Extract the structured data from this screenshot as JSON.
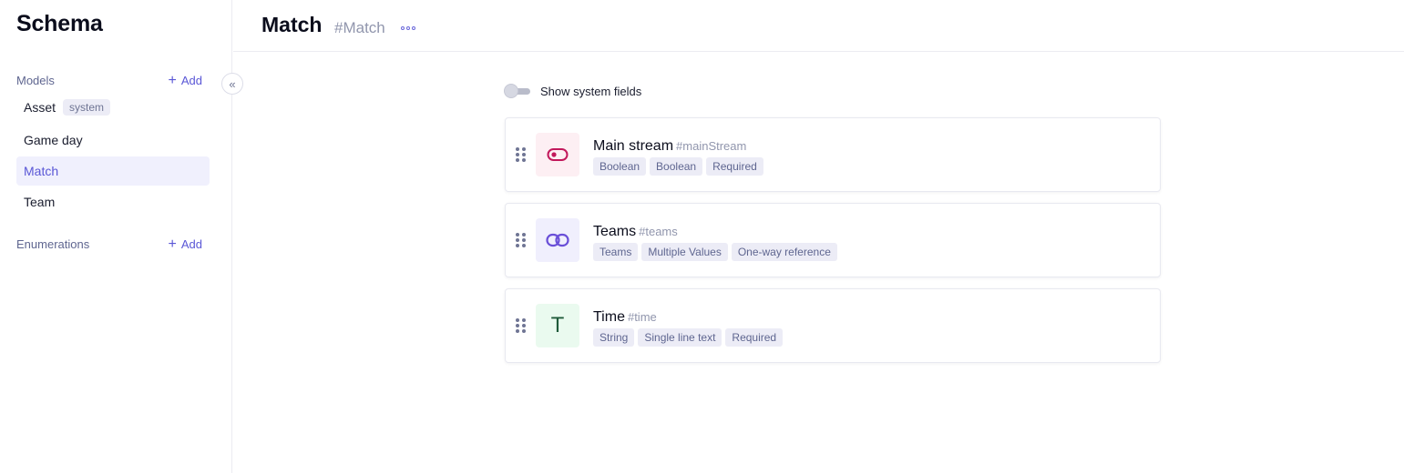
{
  "sidebar": {
    "title": "Schema",
    "models_label": "Models",
    "models_add": "Add",
    "models": [
      {
        "label": "Asset",
        "badge": "system"
      },
      {
        "label": "Game day"
      },
      {
        "label": "Match"
      },
      {
        "label": "Team"
      }
    ],
    "enumerations_label": "Enumerations",
    "enumerations_add": "Add"
  },
  "header": {
    "title": "Match",
    "api_id": "#Match"
  },
  "main": {
    "show_system_fields_label": "Show system fields",
    "show_system_fields_enabled": false,
    "fields": [
      {
        "name": "Main stream",
        "api_id": "#mainStream",
        "icon": "toggle-icon",
        "tags": [
          "Boolean",
          "Boolean",
          "Required"
        ]
      },
      {
        "name": "Teams",
        "api_id": "#teams",
        "icon": "link-icon",
        "tags": [
          "Teams",
          "Multiple Values",
          "One-way reference"
        ]
      },
      {
        "name": "Time",
        "api_id": "#time",
        "icon": "text-T-icon",
        "icon_glyph": "T",
        "tags": [
          "String",
          "Single line text",
          "Required"
        ]
      }
    ]
  },
  "colors": {
    "accent": "#5a57d6",
    "boolean_icon": "#c2185b",
    "boolean_icon_bg": "#fdeff3",
    "reference_icon": "#6a4fd8",
    "reference_icon_bg": "#f0effd",
    "string_icon": "#1f5a3a",
    "string_icon_bg": "#eafaef"
  }
}
